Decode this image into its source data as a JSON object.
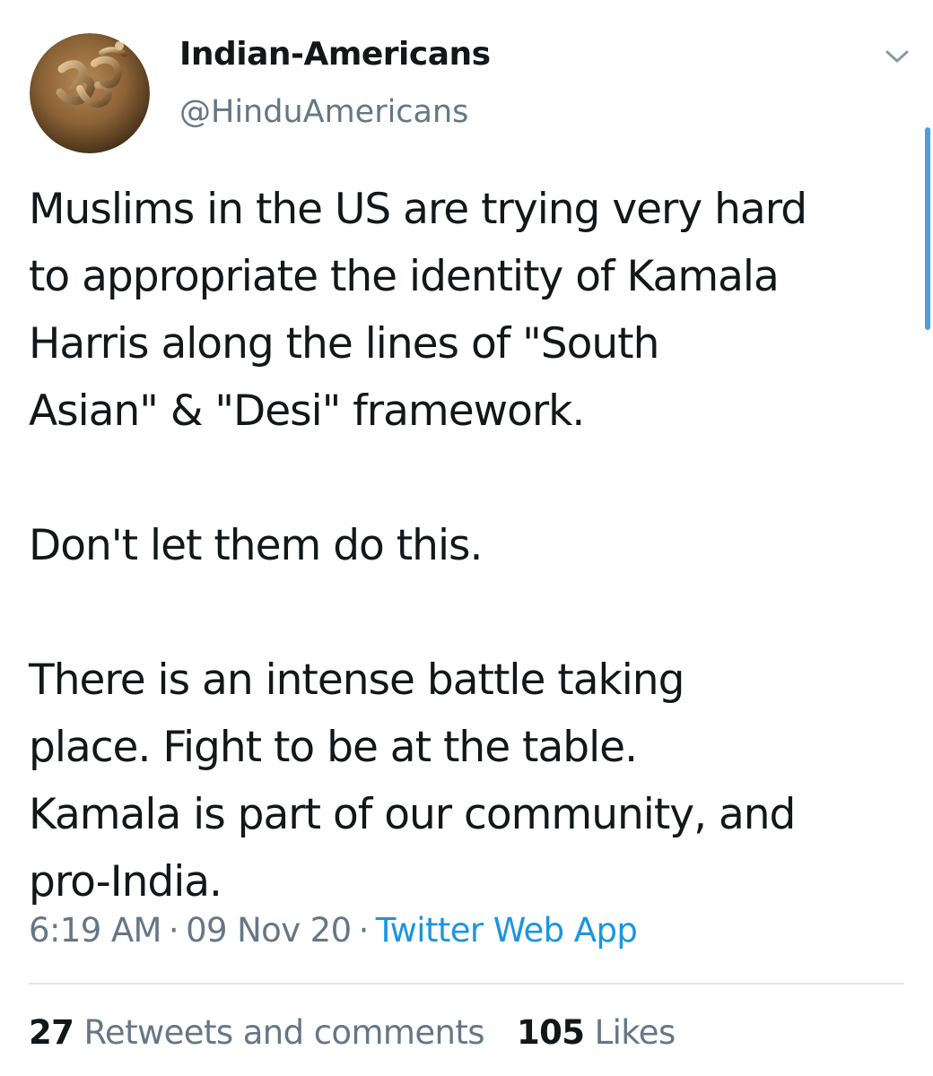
{
  "tweet": {
    "author": {
      "display_name": "Indian-Americans",
      "handle": "@HinduAmericans",
      "avatar_icon": "om-symbol-icon"
    },
    "menu_icon": "chevron-down-icon",
    "text": "Muslims in the US are trying very hard\nto appropriate the identity of Kamala\nHarris along the lines of \"South\nAsian\" & \"Desi\" framework.\n\nDon't let them do this.\n\nThere is an intense battle taking\nplace. Fight to be at the table.\nKamala is part of our community, and\npro-India.",
    "time": "6:19 AM",
    "separator": "·",
    "date": "09 Nov 20",
    "source": "Twitter Web App",
    "stats": {
      "retweets_count": "27",
      "retweets_label": "Retweets and comments",
      "likes_count": "105",
      "likes_label": "Likes"
    }
  },
  "colors": {
    "text": "#14171a",
    "secondary": "#657786",
    "link": "#1b95e0",
    "divider": "#e1e8ed",
    "scrollbar": "#4a9fe0"
  }
}
